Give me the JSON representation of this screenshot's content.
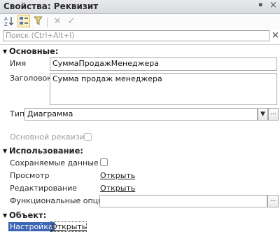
{
  "window": {
    "title": "Свойства: Реквизит",
    "pin_glyph": "▪",
    "close_glyph": "×"
  },
  "toolbar": {
    "sort_az_icon": "sort-az-icon",
    "categories_icon": "categories-icon",
    "filter_icon": "filter-icon",
    "delete_glyph": "✕",
    "accept_glyph": "✓"
  },
  "search": {
    "placeholder": "Поиск (Ctrl+Alt+I)",
    "clear_glyph": "×"
  },
  "groups": {
    "main": {
      "title": "Основные:"
    },
    "usage": {
      "title": "Использование:"
    },
    "object": {
      "title": "Объект:"
    }
  },
  "fields": {
    "name": {
      "label": "Имя",
      "value": "СуммаПродажМенеджера"
    },
    "caption": {
      "label": "Заголовок",
      "value": "Сумма продаж менеджера"
    },
    "type": {
      "label": "Тип",
      "value": "Диаграмма",
      "ellipsis": "..."
    },
    "main_attr": {
      "label": "Основной реквизит"
    },
    "saved": {
      "label": "Сохраняемые данные"
    },
    "view": {
      "label": "Просмотр",
      "link": "Открыть"
    },
    "edit": {
      "label": "Редактирование",
      "link": "Открыть"
    },
    "func_options": {
      "label": "Функциональные опции",
      "ellipsis": "..."
    },
    "setup": {
      "label": "Настройка",
      "link": "Открыть"
    }
  },
  "colors": {
    "selection": "#3b64b4",
    "pressed_button": "#fdf3c6"
  }
}
